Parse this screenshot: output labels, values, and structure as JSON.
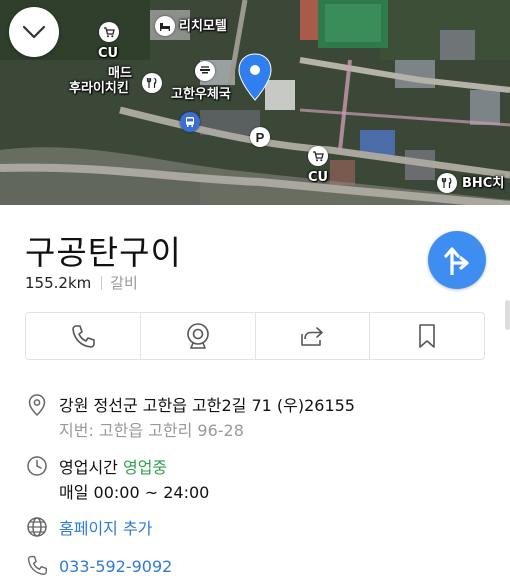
{
  "map": {
    "labels": {
      "richi_motel": "리치모텔",
      "cu_top": "CU",
      "mad_fried": "매드\n후라이치킨",
      "gohan_post": "고한우체국",
      "cu_bottom": "CU",
      "bhc": "BHC치"
    }
  },
  "place": {
    "name": "구공탄구이",
    "distance": "155.2km",
    "category": "갈비"
  },
  "details": {
    "address": "강원 정선군 고한읍 고한2길 71 (우)26155",
    "lot_address": "지번: 고한읍 고한리 96-28",
    "hours_label": "영업시간",
    "hours_status": "영업중",
    "hours_value": "매일 00:00 ~ 24:00",
    "homepage": "홈페이지 추가",
    "phone": "033-592-9092"
  },
  "colors": {
    "accent_blue": "#3d8ef0",
    "open_green": "#2fa04e",
    "link_blue": "#2e7bd8"
  }
}
